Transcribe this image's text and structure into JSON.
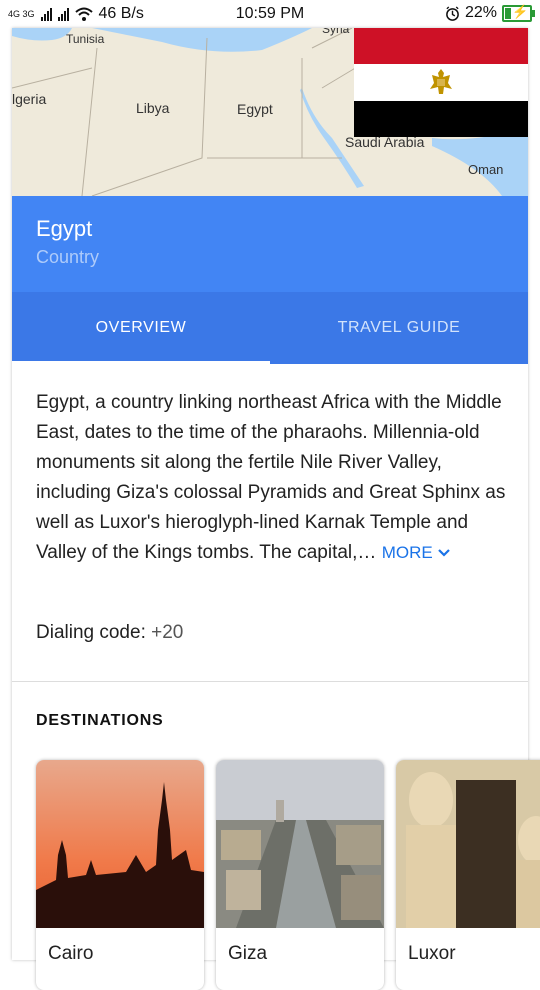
{
  "status_bar": {
    "network": "4G 3G",
    "speed": "46 B/s",
    "time": "10:59 PM",
    "battery": "22%",
    "battery_level": 0.22
  },
  "map": {
    "labels": [
      "Tunisia",
      "lgeria",
      "Libya",
      "Egypt",
      "Syria",
      "Saudi Arabia",
      "Oman"
    ]
  },
  "entity": {
    "title": "Egypt",
    "subtitle": "Country"
  },
  "tabs": [
    {
      "label": "OVERVIEW",
      "active": true
    },
    {
      "label": "TRAVEL GUIDE",
      "active": false
    }
  ],
  "overview": {
    "text": "Egypt, a country linking northeast Africa with the Middle East, dates to the time of the pharaohs. Millennia-old monuments sit along the fertile Nile River Valley, including Giza's colossal Pyramids and Great Sphinx as well as Luxor's hieroglyph-lined Karnak Temple and Valley of the Kings tombs. The capital,…",
    "more_label": "MORE"
  },
  "dialing": {
    "label": "Dialing code:",
    "value": "+20"
  },
  "destinations": {
    "title": "DESTINATIONS",
    "items": [
      {
        "name": "Cairo"
      },
      {
        "name": "Giza"
      },
      {
        "name": "Luxor"
      }
    ]
  },
  "colors": {
    "header_blue": "#4285f4",
    "tabs_blue": "#3b78e7",
    "link_blue": "#1a73e8"
  }
}
